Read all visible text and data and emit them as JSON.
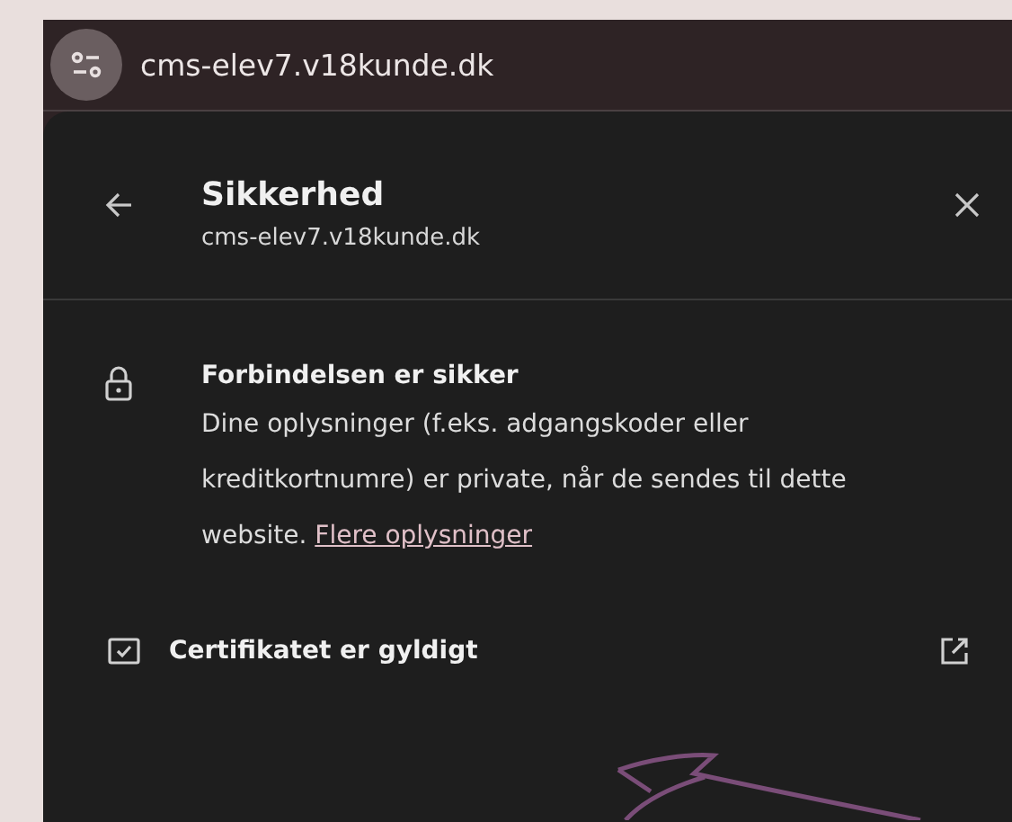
{
  "address_bar": {
    "url": "cms-elev7.v18kunde.dk"
  },
  "panel": {
    "title": "Sikkerhed",
    "subtitle": "cms-elev7.v18kunde.dk"
  },
  "connection": {
    "heading": "Forbindelsen er sikker",
    "text": "Dine oplysninger (f.eks. adgangskoder eller kreditkortnumre) er private, når de sendes til dette website.",
    "link": "Flere oplysninger"
  },
  "certificate": {
    "label": "Certifikatet er gyldigt"
  }
}
